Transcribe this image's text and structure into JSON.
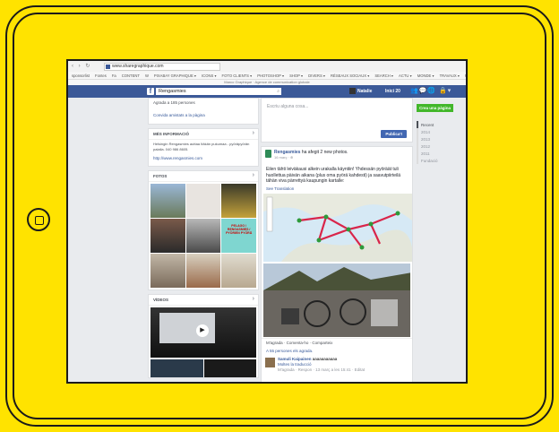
{
  "browser": {
    "url": "www.sharegraphique.com",
    "nav_glyphs": "‹ › ↻",
    "bookmarks": [
      "sponsorlist",
      "Fontes",
      "Fa",
      "CONTENT",
      "W",
      "PIXABAY GRAPHIQUE ▾",
      "ICONS ▾",
      "FOTO CLIENTS ▾",
      "PHOTOSHOP ▾",
      "SHOP ▾",
      "DIVERS ▾",
      "RÉSEAUX SOCIAUX ▾",
      "SEARCH ▾",
      "ACTU ▾",
      "MONDE ▾",
      "TRAVAUX ▾",
      "Photographie",
      "Maison"
    ],
    "notice": "Marco Graphique · Agence de communication globale"
  },
  "fb": {
    "search_value": "Rengasmies",
    "search_icon": "search-icon",
    "user": "Natalie",
    "home": "Inici 20"
  },
  "left": {
    "like_row": "Agrada a 185 persones",
    "invite_row": "Convida amistats a la pàgina",
    "info_title": "MÉS INFORMACIÓ",
    "info_text": "Helsingin Rengasmies auttaa Itäkän pukumaa - pyöräpyörän palalla. 040 986 8605.",
    "info_link": "http://www.rengasmies.com",
    "photos_title": "FOTOS",
    "videos_title": "VÍDEOS",
    "arrow": "›",
    "photo_caption": "PELAGO / RENGASMIES / PYÖRIEN PYÖRÄ"
  },
  "main": {
    "composer_placeholder": "Escriu alguna cosa...",
    "publish": "Publica't",
    "post_name": "Rengasmies",
    "post_added": " ha afegit 2 new photos.",
    "post_time": "16 març · ⊕",
    "post_text": "Eilen tähti leiväkausi alkein urakalla käyntiin! Yhdessän pyöräät tuli huollettua päivän aikana (plus oma pyörä kahdesti) ja saavutpiirteilä tähän viva pärrettyä kaupungin kartalle:",
    "translate": "See Translation",
    "actions": "M'agrada · Comenta-ho · Comparteix",
    "likes": "A 55 persones els agrada.",
    "comment_name": "Samuli Kaipainen",
    "comment_text": "aaaaaaaaaaa",
    "comment_sub": "Moltes la traducció",
    "comment_meta": "M'agrada · Respon · 13 març a les 15:41 · Editat"
  },
  "right": {
    "create_page": "Crea una pàgina",
    "years": [
      "Recent",
      "2014",
      "2013",
      "2012",
      "2011",
      "Fundació"
    ]
  }
}
